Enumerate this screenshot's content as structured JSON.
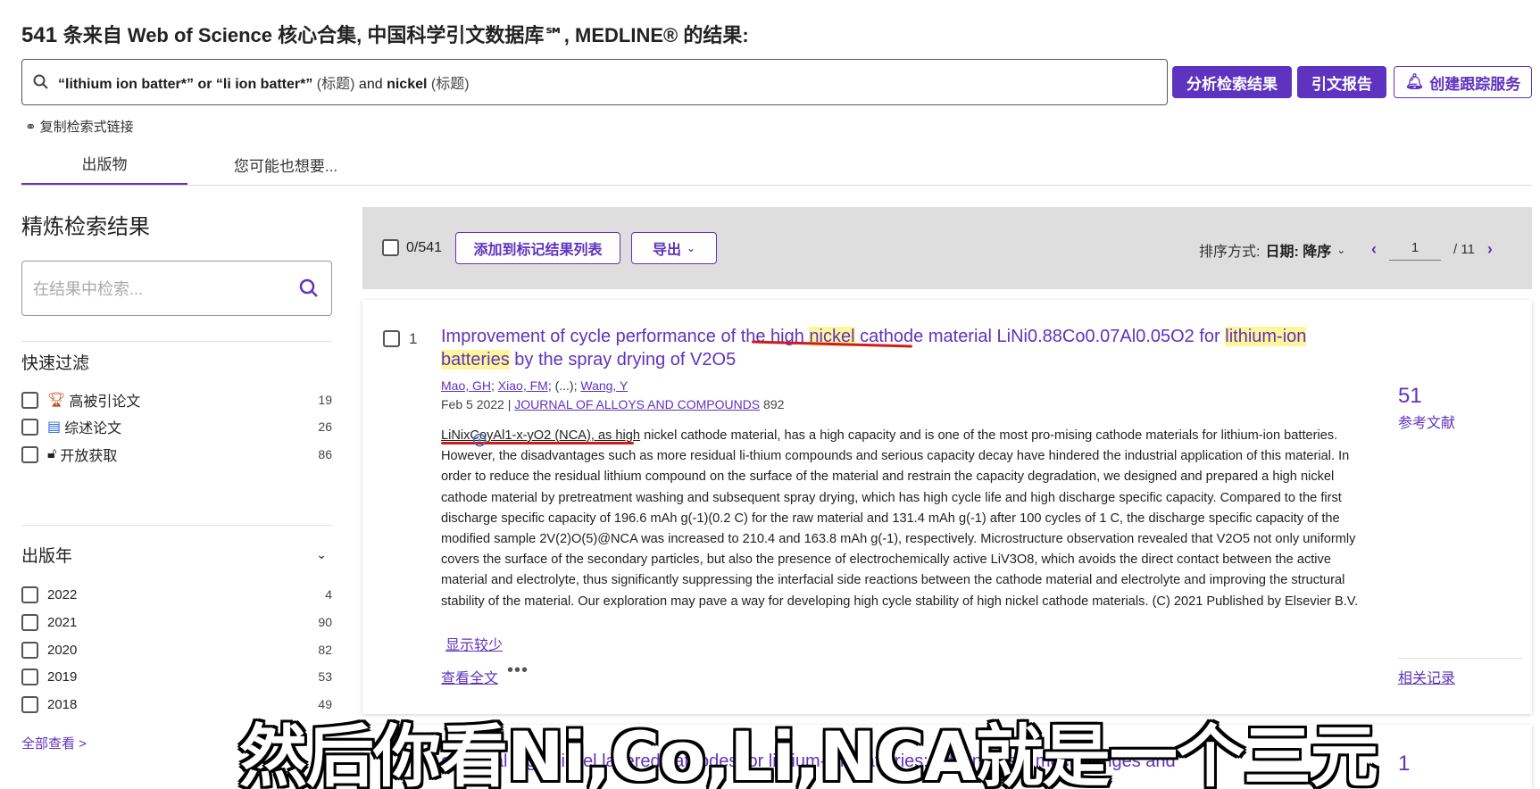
{
  "header": {
    "count": "541",
    "title_rest": "条来自 Web of Science 核心合集, 中国科学引文数据库℠, MEDLINE® 的结果:",
    "query_term1": "“lithium ion batter*” or “li ion batter*”",
    "query_field1": "(标题)",
    "query_and": "and",
    "query_term2": "nickel",
    "query_field2": "(标题)",
    "btn_analyze": "分析检索结果",
    "btn_citation": "引文报告",
    "btn_alert": "创建跟踪服务",
    "copy_link": "复制检索式链接"
  },
  "tabs": [
    {
      "label": "出版物",
      "active": true
    },
    {
      "label": "您可能也想要..."
    }
  ],
  "sidebar": {
    "refine_title": "精炼检索结果",
    "search_placeholder": "在结果中检索...",
    "quick_title": "快速过滤",
    "quick_filters": [
      {
        "label": "高被引论文",
        "count": "19",
        "icon": "trophy-icon"
      },
      {
        "label": "综述论文",
        "count": "26",
        "icon": "document-icon"
      },
      {
        "label": "开放获取",
        "count": "86",
        "icon": "unlock-icon"
      }
    ],
    "year_title": "出版年",
    "years": [
      {
        "label": "2022",
        "count": "4"
      },
      {
        "label": "2021",
        "count": "90"
      },
      {
        "label": "2020",
        "count": "82"
      },
      {
        "label": "2019",
        "count": "53"
      },
      {
        "label": "2018",
        "count": "49"
      }
    ],
    "view_all": "全部查看 >"
  },
  "toolbar": {
    "selected": "0/541",
    "add_btn": "添加到标记结果列表",
    "export_btn": "导出",
    "sort_label": "排序方式:",
    "sort_value": "日期: 降序",
    "page": "1",
    "total_pages": "/ 11"
  },
  "record1": {
    "num": "1",
    "title_a": "Improvement of cycle performance of the high ",
    "title_hl1": "nickel",
    "title_b": " cathode material LiNi0.88Co0.07Al0.05O2 for ",
    "title_hl2": "lithium-ion batteries",
    "title_c": " by the spray drying of V2O5",
    "author1": "Mao, GH",
    "author2": "Xiao, FM",
    "author_mid": "(...);",
    "author3": "Wang, Y",
    "date": "Feb 5 2022 |",
    "journal": "JOURNAL OF ALLOYS AND COMPOUNDS",
    "volume": "892",
    "abstract_lead": "LiNixCoyAl1-x-yO2 (NCA), as high",
    "abstract": " nickel cathode material, has a high capacity and is one of the most pro-mising cathode materials for lithium-ion batteries. However, the disadvantages such as more residual li-thium compounds and serious capacity decay have hindered the industrial application of this material. In order to reduce the residual lithium compound on the surface of the material and restrain the capacity degradation, we designed and prepared a high nickel cathode material by pretreatment washing and subsequent spray drying, which has high cycle life and high discharge specific capacity. Compared to the first discharge specific capacity of 196.6 mAh g(-1)(0.2 C) for the raw material and 131.4 mAh g(-1) after 100 cycles of 1 C, the discharge specific capacity of the modified sample 2V(2)O(5)@NCA was increased to 210.4 and 163.8 mAh g(-1), respectively. Microstructure observation revealed that V2O5 not only uniformly covers the surface of the secondary particles, but also the presence of electrochemically active LiV3O8, which avoids the direct contact between the active material and electrolyte, thus significantly suppressing the interfacial side reactions between the cathode material and electrolyte and improving the structural stability of the material. Our exploration may pave a way for developing high cycle stability of high nickel cathode materials. (C) 2021 Published by Elsevier B.V.",
    "show_less": "显示较少",
    "view_full": "查看全文",
    "more": "•••",
    "ref_count": "51",
    "ref_label": "参考文献",
    "related": "相关记录"
  },
  "record2": {
    "title_peek": "e crystal high nickel layered cathodes for lithium-ion batteries: advantages, mech      llenges and",
    "count": "1"
  },
  "caption": "然后你看Ni,Co,Li,NCA就是一个三元",
  "colors": {
    "accent": "#5e33bf",
    "highlight": "#fff59a",
    "annotation": "#d11b1b"
  }
}
